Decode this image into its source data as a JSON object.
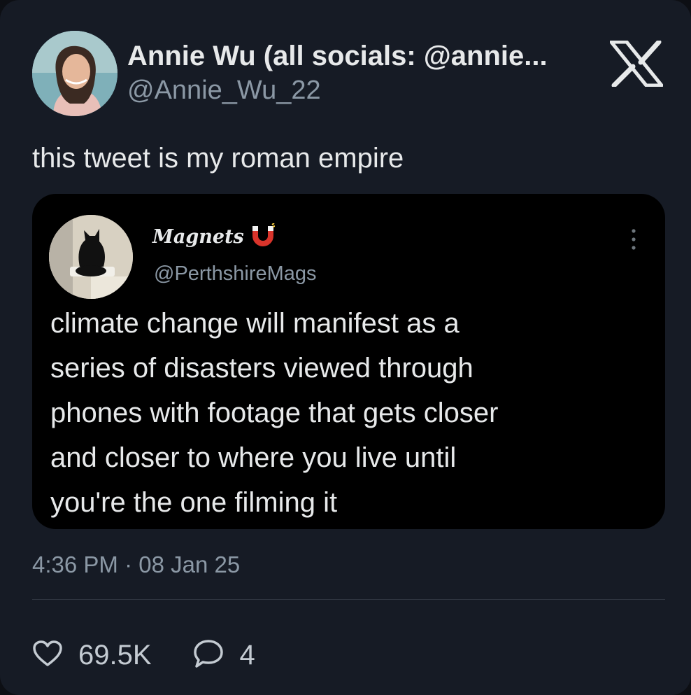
{
  "tweet": {
    "author": {
      "display_name": "Annie Wu (all socials: @annie...",
      "handle": "@Annie_Wu_22"
    },
    "text": "this tweet is my roman empire",
    "platform_icon": "x-logo-icon",
    "timestamp": "4:36 PM · 08 Jan 25",
    "stats": {
      "likes": "69.5K",
      "replies": "4"
    }
  },
  "quoted_tweet": {
    "author": {
      "display_name": "Magnets",
      "name_icon": "magnet-icon",
      "handle": "@PerthshireMags"
    },
    "lines": [
      "climate change will manifest as a",
      "series of disasters viewed through",
      "phones with footage that gets closer",
      "and closer to where you live until",
      "you're the one filming it"
    ]
  },
  "colors": {
    "background": "#161b25",
    "quote_background": "#000000",
    "text": "#e7e9ea",
    "secondary_text": "#8b98a5",
    "magnet_red": "#d9342b"
  }
}
